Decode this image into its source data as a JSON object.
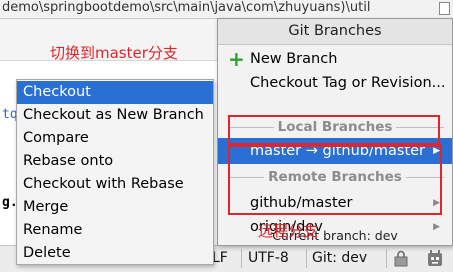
{
  "ide": {
    "path_text": "demo\\springbootdemo\\src\\main\\java\\com\\zhuyuans)\\util",
    "code_fragment_1": "tq",
    "code_fragment_2": "g."
  },
  "status_bar": {
    "line_sep": "LF",
    "encoding": "UTF-8",
    "git_branch": "Git: dev"
  },
  "git_branches_popup": {
    "title": "Git Branches",
    "new_branch": "New Branch",
    "checkout_tag": "Checkout Tag or Revision...",
    "local_header": "Local Branches",
    "local_branches": [
      "master → github/master"
    ],
    "remote_header": "Remote Branches",
    "remote_branches": [
      "github/master",
      "origin/dev"
    ],
    "current_branch": "Current branch: dev"
  },
  "context_menu": {
    "items": [
      "Checkout",
      "Checkout as New Branch",
      "Compare",
      "Rebase onto",
      "Checkout with Rebase",
      "Merge",
      "Rename",
      "Delete"
    ],
    "selected": "Checkout"
  },
  "annotations": {
    "switch_to_master": "切换到master分支",
    "remote_branches": "远程分支"
  },
  "colors": {
    "selection": "#2a6fd4",
    "annotation_red": "#e0262a",
    "plus_green": "#2ea02e"
  },
  "icons": {
    "plus": "plus-icon",
    "submenu": "chevron-right-icon",
    "lock": "lock-icon",
    "face": "hector-face-icon"
  }
}
